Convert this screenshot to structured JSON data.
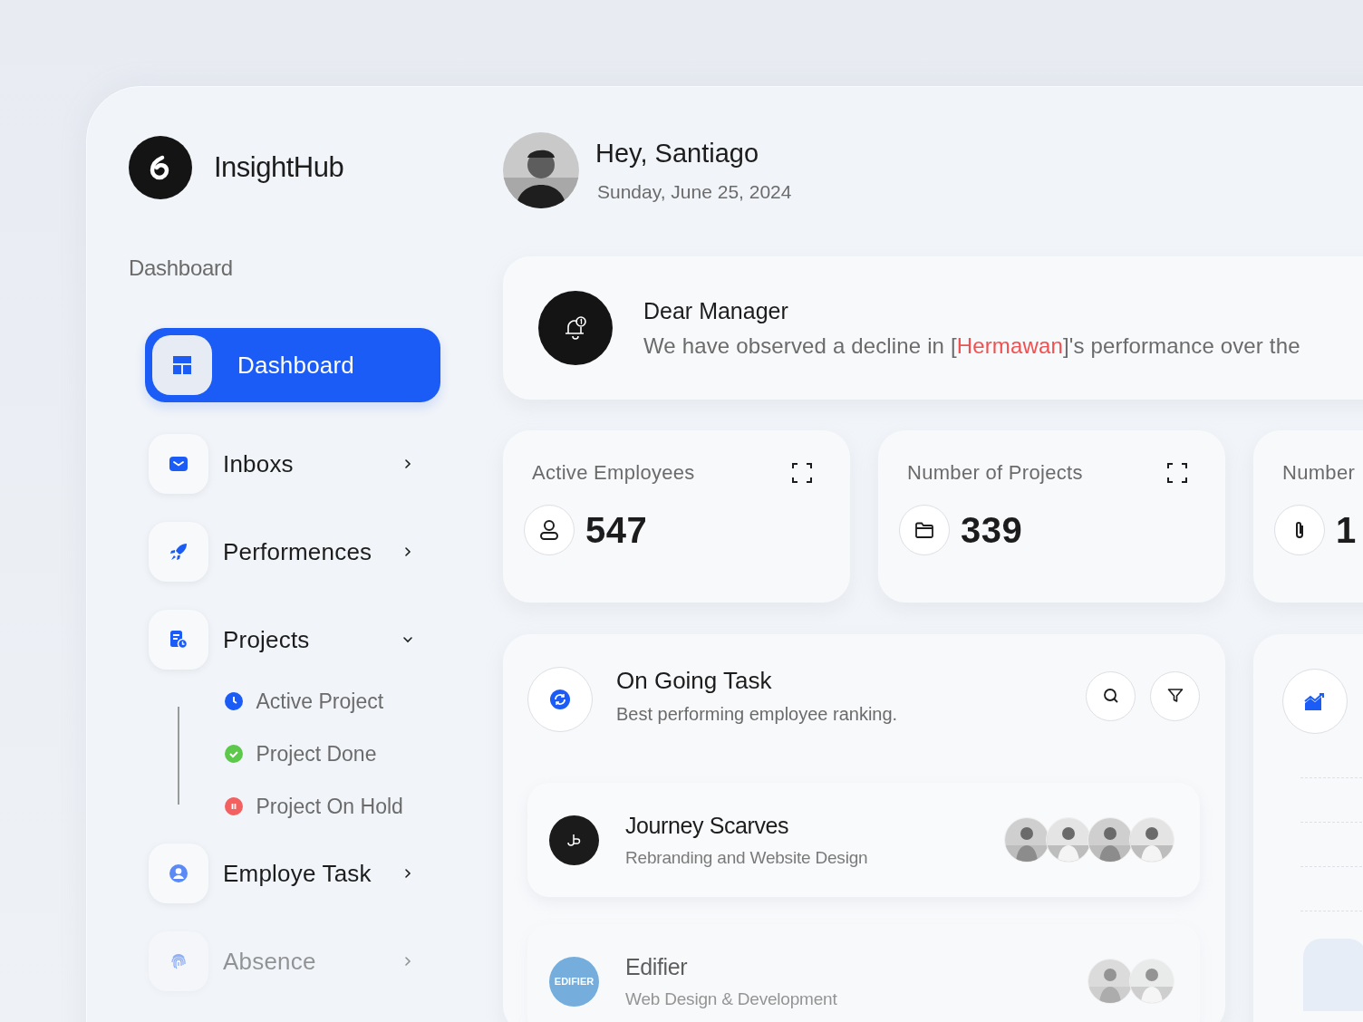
{
  "brand": {
    "name": "InsightHub"
  },
  "user": {
    "greeting": "Hey, Santiago",
    "date": "Sunday, June 25, 2024"
  },
  "sidebar": {
    "section_title": "Dashboard",
    "items": [
      {
        "label": "Dashboard",
        "kind": "layout",
        "selected": true,
        "faded": false
      },
      {
        "label": "Inboxs",
        "kind": "mail",
        "selected": false,
        "expanded": false,
        "faded": false
      },
      {
        "label": "Performences",
        "kind": "rocket",
        "selected": false,
        "expanded": false,
        "faded": false
      },
      {
        "label": "Projects",
        "kind": "doc",
        "selected": false,
        "expanded": true,
        "faded": false,
        "children": [
          {
            "label": "Active Project",
            "kind": "active",
            "color": "#1a5cf5"
          },
          {
            "label": "Project Done",
            "kind": "done",
            "color": "#5cc94a"
          },
          {
            "label": "Project On Hold",
            "kind": "hold",
            "color": "#f26060"
          }
        ]
      },
      {
        "label": "Employe Task",
        "kind": "person",
        "selected": false,
        "expanded": false,
        "faded": false
      },
      {
        "label": "Absence",
        "kind": "fingerprint",
        "selected": false,
        "expanded": false,
        "faded": true
      }
    ]
  },
  "notification": {
    "title": "Dear Manager",
    "message_start": "We have observed a decline in [",
    "name": "Hermawan",
    "message_end": "]'s performance over the"
  },
  "stats": [
    {
      "label": "Active Employees",
      "value": "547",
      "kind": "user",
      "expand": true
    },
    {
      "label": "Number of Projects",
      "value": "339",
      "kind": "folder",
      "expand": true
    },
    {
      "label": "Number",
      "value": "1",
      "kind": "clip"
    }
  ],
  "task_panel": {
    "title": "On Going Task",
    "subtitle": "Best performing employee ranking.",
    "rows": [
      {
        "name": "Journey Scarves",
        "description": "Rebranding and Website Design",
        "kind": "mark",
        "faded": false
      },
      {
        "name": "Edifier",
        "description": "Web Design & Development",
        "kind": "badge",
        "logo_text": "EDIFIER",
        "faded": true
      }
    ]
  }
}
